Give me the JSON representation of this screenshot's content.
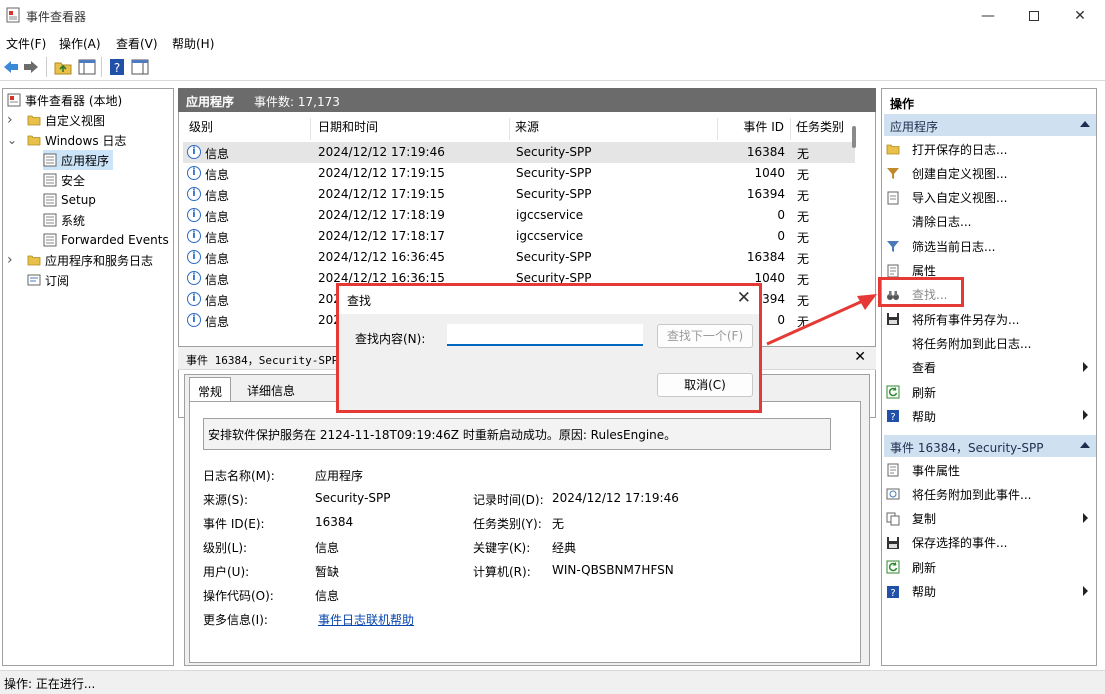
{
  "window": {
    "title": "事件查看器"
  },
  "menu": [
    "文件(F)",
    "操作(A)",
    "查看(V)",
    "帮助(H)"
  ],
  "tree": [
    {
      "label": "事件查看器 (本地)",
      "indent": 0,
      "expander": "",
      "icon": "event-viewer-icon"
    },
    {
      "label": "自定义视图",
      "indent": 1,
      "expander": "›",
      "icon": "folder-icon"
    },
    {
      "label": "Windows 日志",
      "indent": 1,
      "expander": "⌄",
      "icon": "folder-icon"
    },
    {
      "label": "应用程序",
      "indent": 2,
      "expander": "",
      "icon": "log-icon",
      "selected": true
    },
    {
      "label": "安全",
      "indent": 2,
      "expander": "",
      "icon": "log-icon"
    },
    {
      "label": "Setup",
      "indent": 2,
      "expander": "",
      "icon": "log-icon"
    },
    {
      "label": "系统",
      "indent": 2,
      "expander": "",
      "icon": "log-icon"
    },
    {
      "label": "Forwarded Events",
      "indent": 2,
      "expander": "",
      "icon": "log-icon"
    },
    {
      "label": "应用程序和服务日志",
      "indent": 1,
      "expander": "›",
      "icon": "folder-icon"
    },
    {
      "label": "订阅",
      "indent": 1,
      "expander": "",
      "icon": "subscription-icon"
    }
  ],
  "center": {
    "log_name": "应用程序",
    "event_count": "事件数: 17,173"
  },
  "columns": [
    "级别",
    "日期和时间",
    "来源",
    "事件 ID",
    "任务类别"
  ],
  "rows": [
    {
      "level": "信息",
      "datetime": "2024/12/12 17:19:46",
      "source": "Security-SPP",
      "id": "16384",
      "task": "无"
    },
    {
      "level": "信息",
      "datetime": "2024/12/12 17:19:15",
      "source": "Security-SPP",
      "id": "1040",
      "task": "无"
    },
    {
      "level": "信息",
      "datetime": "2024/12/12 17:19:15",
      "source": "Security-SPP",
      "id": "16394",
      "task": "无"
    },
    {
      "level": "信息",
      "datetime": "2024/12/12 17:18:19",
      "source": "igccservice",
      "id": "0",
      "task": "无"
    },
    {
      "level": "信息",
      "datetime": "2024/12/12 17:18:17",
      "source": "igccservice",
      "id": "0",
      "task": "无"
    },
    {
      "level": "信息",
      "datetime": "2024/12/12 16:36:45",
      "source": "Security-SPP",
      "id": "16384",
      "task": "无"
    },
    {
      "level": "信息",
      "datetime": "2024/12/12 16:36:15",
      "source": "Security-SPP",
      "id": "1040",
      "task": "无"
    },
    {
      "level": "信息",
      "datetime": "202",
      "source": "",
      "id": "394",
      "task": "无"
    },
    {
      "level": "信息",
      "datetime": "202",
      "source": "",
      "id": "0",
      "task": "无"
    }
  ],
  "detail": {
    "header": "事件 16384，Security-SPP",
    "tabs": [
      "常规",
      "详细信息"
    ],
    "description": "安排软件保护服务在 2124-11-18T09:19:46Z 时重新启动成功。原因: RulesEngine。",
    "fields": {
      "log_name_label": "日志名称(M):",
      "log_name": "应用程序",
      "source_label": "来源(S):",
      "source": "Security-SPP",
      "recorded_label": "记录时间(D):",
      "recorded": "2024/12/12 17:19:46",
      "event_id_label": "事件 ID(E):",
      "event_id": "16384",
      "task_label": "任务类别(Y):",
      "task": "无",
      "level_label": "级别(L):",
      "level": "信息",
      "keywords_label": "关键字(K):",
      "keywords": "经典",
      "user_label": "用户(U):",
      "user": "暂缺",
      "computer_label": "计算机(R):",
      "computer": "WIN-QBSBNM7HFSN",
      "opcode_label": "操作代码(O):",
      "opcode": "信息",
      "more_info_label": "更多信息(I):",
      "more_info_link": "事件日志联机帮助"
    }
  },
  "actions": {
    "title": "操作",
    "section1": "应用程序",
    "items1": [
      {
        "label": "打开保存的日志...",
        "icon": "open-folder-icon"
      },
      {
        "label": "创建自定义视图...",
        "icon": "filter-create-icon"
      },
      {
        "label": "导入自定义视图...",
        "icon": "import-icon"
      },
      {
        "label": "清除日志...",
        "icon": "blank-icon"
      },
      {
        "label": "筛选当前日志...",
        "icon": "filter-icon"
      },
      {
        "label": "属性",
        "icon": "properties-icon"
      },
      {
        "label": "查找...",
        "icon": "binoculars-icon",
        "muted": true
      },
      {
        "label": "将所有事件另存为...",
        "icon": "save-icon"
      },
      {
        "label": "将任务附加到此日志...",
        "icon": "blank-icon"
      },
      {
        "label": "查看",
        "icon": "blank-icon",
        "submenu": true
      },
      {
        "label": "刷新",
        "icon": "refresh-icon"
      },
      {
        "label": "帮助",
        "icon": "help-icon",
        "submenu": true
      }
    ],
    "section2": "事件 16384，Security-SPP",
    "items2": [
      {
        "label": "事件属性",
        "icon": "properties-icon"
      },
      {
        "label": "将任务附加到此事件...",
        "icon": "task-icon"
      },
      {
        "label": "复制",
        "icon": "copy-icon",
        "submenu": true
      },
      {
        "label": "保存选择的事件...",
        "icon": "save-icon"
      },
      {
        "label": "刷新",
        "icon": "refresh-icon"
      },
      {
        "label": "帮助",
        "icon": "help-icon",
        "submenu": true
      }
    ]
  },
  "dialog": {
    "title": "查找",
    "find_label": "查找内容(N):",
    "find_value": "",
    "find_next": "查找下一个(F)",
    "cancel": "取消(C)"
  },
  "status": "操作:  正在进行..."
}
